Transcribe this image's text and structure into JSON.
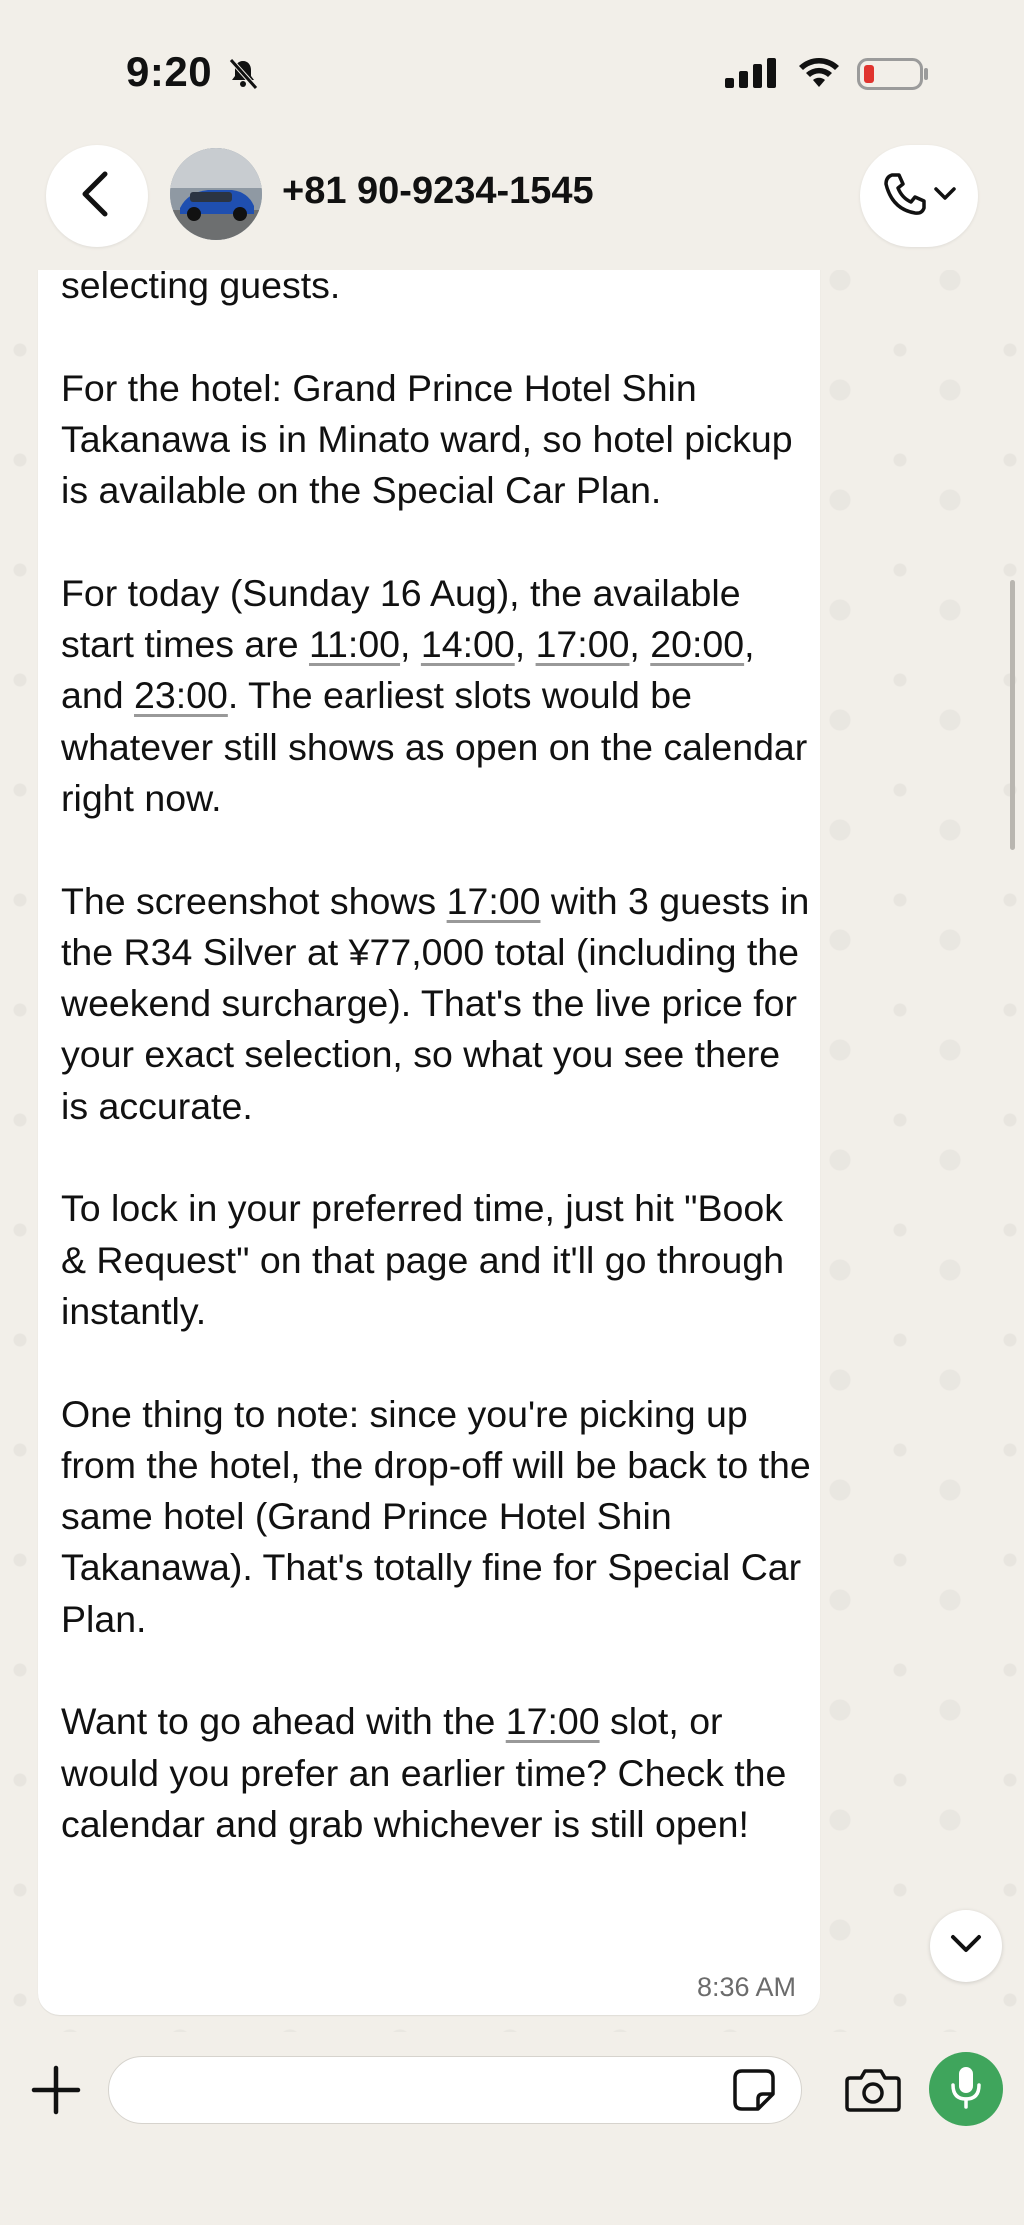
{
  "status_bar": {
    "time": "9:20"
  },
  "header": {
    "contact_name": "+81 90-9234-1545"
  },
  "message": {
    "segments": [
      {
        "t": "selecting guests.\n\nFor the hotel: Grand Prince Hotel Shin Takanawa is in Minato ward, so hotel pickup is available on the Special Car Plan.\n\nFor today (Sunday 16 Aug), the available start times are "
      },
      {
        "t": "11:00",
        "u": true
      },
      {
        "t": ", "
      },
      {
        "t": "14:00",
        "u": true
      },
      {
        "t": ", "
      },
      {
        "t": "17:00",
        "u": true
      },
      {
        "t": ", "
      },
      {
        "t": "20:00",
        "u": true
      },
      {
        "t": ",\nand "
      },
      {
        "t": "23:00",
        "u": true
      },
      {
        "t": ". The earliest slots would be whatever still shows as open on the calendar right now.\n\nThe screenshot shows "
      },
      {
        "t": "17:00",
        "u": true
      },
      {
        "t": " with 3 guests in the R34 Silver at ¥77,000 total (including the weekend surcharge). That's the live price for your exact selection, so what you see there is accurate.\n\nTo lock in your preferred time, just hit \"Book & Request\" on that page and it'll go through instantly.\n\nOne thing to note: since you're picking up from the hotel, the drop-off will be back to the same hotel (Grand Prince Hotel Shin Takanawa). That's totally fine for Special Car Plan.\n\nWant to go ahead with the "
      },
      {
        "t": "17:00",
        "u": true
      },
      {
        "t": " slot, or would you prefer an earlier time? Check the calendar and grab whichever is still open!"
      }
    ],
    "time": "8:36 AM"
  },
  "composer": {
    "value": "",
    "placeholder": ""
  },
  "colors": {
    "background": "#f2efe9",
    "bubble": "#ffffff",
    "mic_button": "#3fa55c",
    "battery_low": "#e0342f"
  },
  "icons": [
    "back-chevron-icon",
    "bell-slash-icon",
    "signal-icon",
    "wifi-icon",
    "battery-icon",
    "phone-icon",
    "chevron-down-icon",
    "plus-icon",
    "sticker-icon",
    "camera-icon",
    "microphone-icon"
  ]
}
